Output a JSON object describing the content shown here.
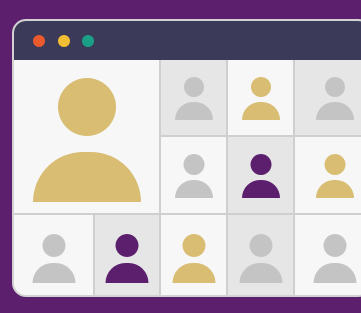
{
  "colors": {
    "frame_background": "#5b1f6e",
    "window_background": "#f7f7f7",
    "titlebar": "#3b3a59",
    "tile_light": "#f7f7f7",
    "tile_shaded": "#e6e6e6",
    "grid_line": "#cfcfcf",
    "avatar_gray": "#c4c4c4",
    "avatar_gold": "#d8bd72",
    "avatar_purple": "#5b1f6e"
  },
  "titlebar": {
    "window_controls": [
      {
        "name": "close-dot",
        "color": "#ea5a2d"
      },
      {
        "name": "minimize-dot",
        "color": "#f3bd33"
      },
      {
        "name": "maximize-dot",
        "color": "#1aa087"
      }
    ]
  },
  "participants": [
    {
      "role": "featured",
      "avatar_color": "gold",
      "tile": "light"
    },
    {
      "role": "thumbnail",
      "avatar_color": "gray",
      "tile": "shaded"
    },
    {
      "role": "thumbnail",
      "avatar_color": "gold",
      "tile": "light"
    },
    {
      "role": "thumbnail",
      "avatar_color": "gray",
      "tile": "shaded"
    },
    {
      "role": "thumbnail",
      "avatar_color": "gray",
      "tile": "light"
    },
    {
      "role": "thumbnail",
      "avatar_color": "purple",
      "tile": "shaded"
    },
    {
      "role": "thumbnail",
      "avatar_color": "gold",
      "tile": "light"
    },
    {
      "role": "thumbnail",
      "avatar_color": "gray",
      "tile": "light"
    },
    {
      "role": "thumbnail",
      "avatar_color": "purple",
      "tile": "shaded"
    },
    {
      "role": "thumbnail",
      "avatar_color": "gold",
      "tile": "light"
    },
    {
      "role": "thumbnail",
      "avatar_color": "gray",
      "tile": "shaded"
    },
    {
      "role": "thumbnail",
      "avatar_color": "gray",
      "tile": "light"
    }
  ]
}
